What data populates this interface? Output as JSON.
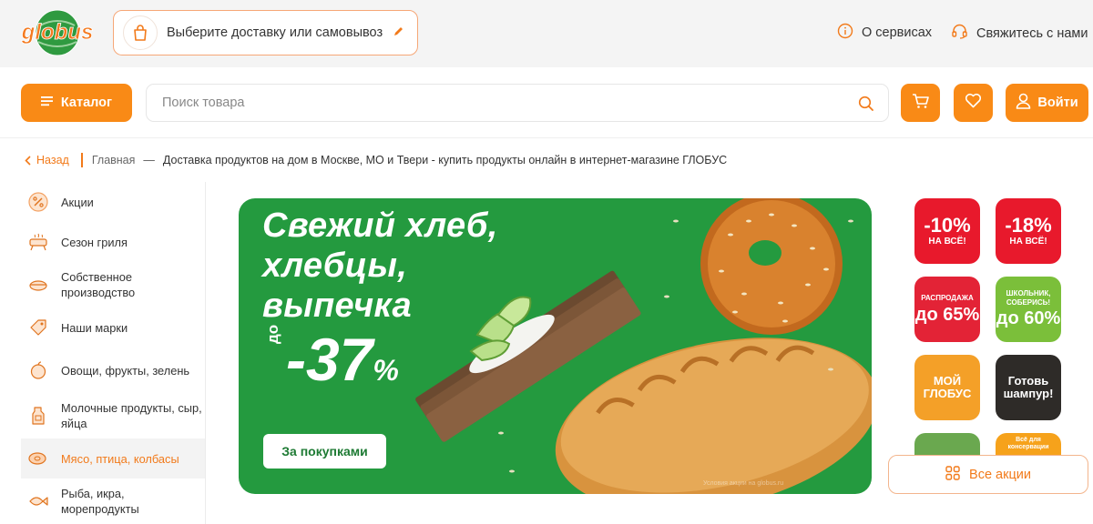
{
  "brand": {
    "logo_text": "globus"
  },
  "header": {
    "delivery_label": "Выберите доставку или самовывоз",
    "services_label": "О сервисах",
    "contact_label": "Свяжитесь с нами"
  },
  "toolbar": {
    "catalog_label": "Каталог",
    "search_placeholder": "Поиск товара",
    "login_label": "Войти"
  },
  "breadcrumb": {
    "back_label": "Назад",
    "home_label": "Главная",
    "dash": "—",
    "current_label": "Доставка продуктов на дом в Москве, МО и Твери - купить продукты онлайн в интернет-магазине ГЛОБУС"
  },
  "sidebar": {
    "items": [
      {
        "label": "Акции",
        "icon": "percent-icon"
      },
      {
        "label": "Сезон гриля",
        "icon": "grill-icon"
      },
      {
        "label": "Собственное производство",
        "icon": "pot-icon"
      },
      {
        "label": "Наши марки",
        "icon": "tag-icon"
      },
      {
        "label": "Овощи, фрукты, зелень",
        "icon": "apple-icon"
      },
      {
        "label": "Молочные продукты, сыр, яйца",
        "icon": "milk-icon"
      },
      {
        "label": "Мясо, птица, колбасы",
        "icon": "meat-icon",
        "active": true
      },
      {
        "label": "Рыба, икра, морепродукты",
        "icon": "fish-icon"
      }
    ]
  },
  "banner": {
    "title_line1": "Свежий хлеб,",
    "title_line2": "хлебцы,",
    "title_line3": "выпечка",
    "discount_prefix": "до",
    "discount_value": "-37",
    "discount_unit": "%",
    "cta_label": "За покупками",
    "fine_print": "Условия акции на globus.ru"
  },
  "promos": [
    {
      "big": "-10%",
      "small": "НА ВСЁ!",
      "color": "#e8192c"
    },
    {
      "big": "-18%",
      "small": "НА ВСЁ!",
      "color": "#e8192c"
    },
    {
      "small": "РАСПРОДАЖА",
      "big": "до 65%",
      "color": "#e32336"
    },
    {
      "small": "ШКОЛЬНИК, СОБЕРИСЬ!",
      "big": "до 60%",
      "color": "#7bbf3a"
    },
    {
      "big": "МОЙ ГЛОБУС",
      "small": "",
      "color": "#f4a028"
    },
    {
      "big": "Готовь шампур!",
      "small": "",
      "color": "#2e2b28"
    },
    {
      "big": "",
      "small": "",
      "color": "#6aa84f"
    },
    {
      "big": "",
      "small": "Всё для консервации",
      "color": "#f6a21b"
    }
  ],
  "all_promos_label": "Все акции",
  "colors": {
    "accent": "#f98a16",
    "banner_green": "#249a3f",
    "active_text": "#f27a1a"
  }
}
